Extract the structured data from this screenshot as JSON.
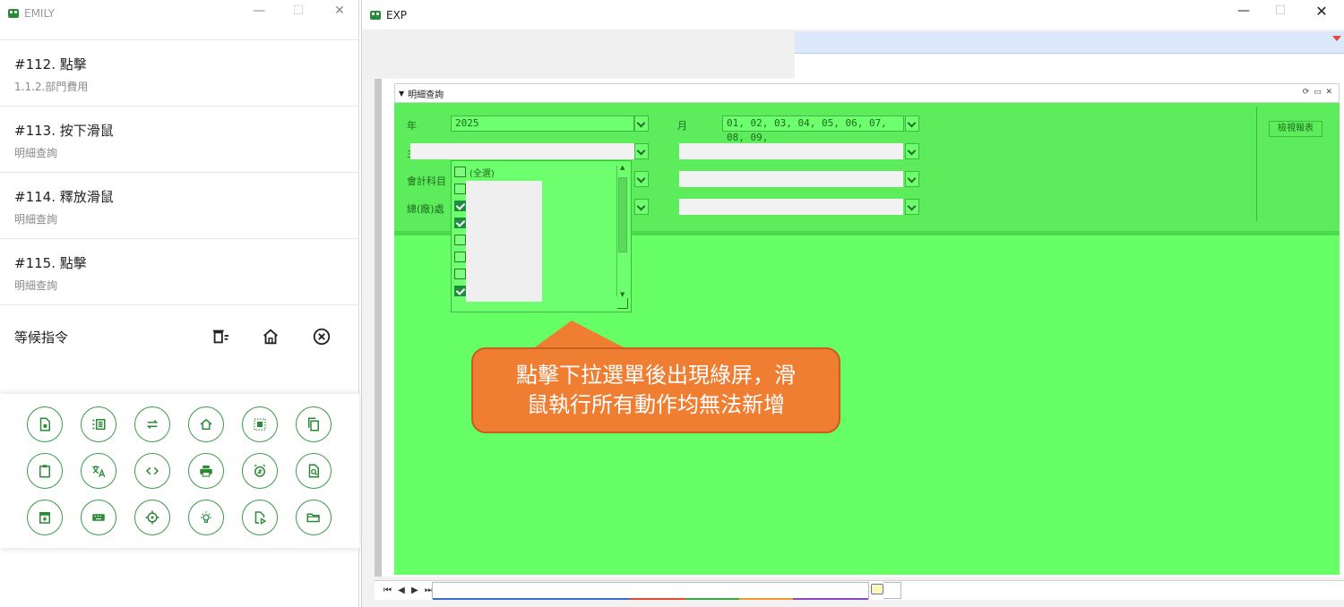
{
  "emily": {
    "title": "EMILY",
    "win_min": "—",
    "win_max": "☐",
    "win_close": "✕",
    "steps": [
      {
        "title": "#112. 點擊",
        "sub": "1.1.2.部門費用"
      },
      {
        "title": "#113. 按下滑鼠",
        "sub": "明細查詢"
      },
      {
        "title": "#114. 釋放滑鼠",
        "sub": "明細查詢"
      },
      {
        "title": "#115. 點擊",
        "sub": "明細查詢"
      }
    ],
    "wait_label": "等候指令",
    "toolbar_icons": [
      "file-icon",
      "list-icon",
      "repeat-icon",
      "home-icon",
      "select-icon",
      "copy-icon",
      "clipboard-icon",
      "translate-icon",
      "code-icon",
      "print-icon",
      "alarm-icon",
      "file-search-icon",
      "archive-icon",
      "keyboard-icon",
      "target-icon",
      "lightbulb-icon",
      "play-file-icon",
      "folder-icon"
    ]
  },
  "exp": {
    "title": "EXP",
    "win_min": "—",
    "win_max": "☐",
    "win_close": "✕",
    "panel_title": "明細查詢",
    "panel_controls": "⟳ ▭ ✕",
    "filters": {
      "year_label": "年",
      "year_value": "2025",
      "month_label": "月",
      "month_value": "01, 02, 03, 04, 05, 06, 07, 08, 09,",
      "row2_label": "主",
      "account_label": "會計科目",
      "dept_label": "總(廠)處",
      "report_button": "檢視報表"
    },
    "dropdown": {
      "all_label": "(全選)",
      "items_checked": [
        false,
        false,
        true,
        true,
        false,
        false,
        false,
        true
      ]
    },
    "callout_line1": "點擊下拉選單後出現綠屏，滑",
    "callout_line2": "鼠執行所有動作均無法新增",
    "nav_arrows": "⏮ ◀ ▶ ⏭",
    "colors": {
      "green_overlay": "#66ff66",
      "callout": "#ef7d32",
      "accent": "#3a9a46"
    }
  }
}
